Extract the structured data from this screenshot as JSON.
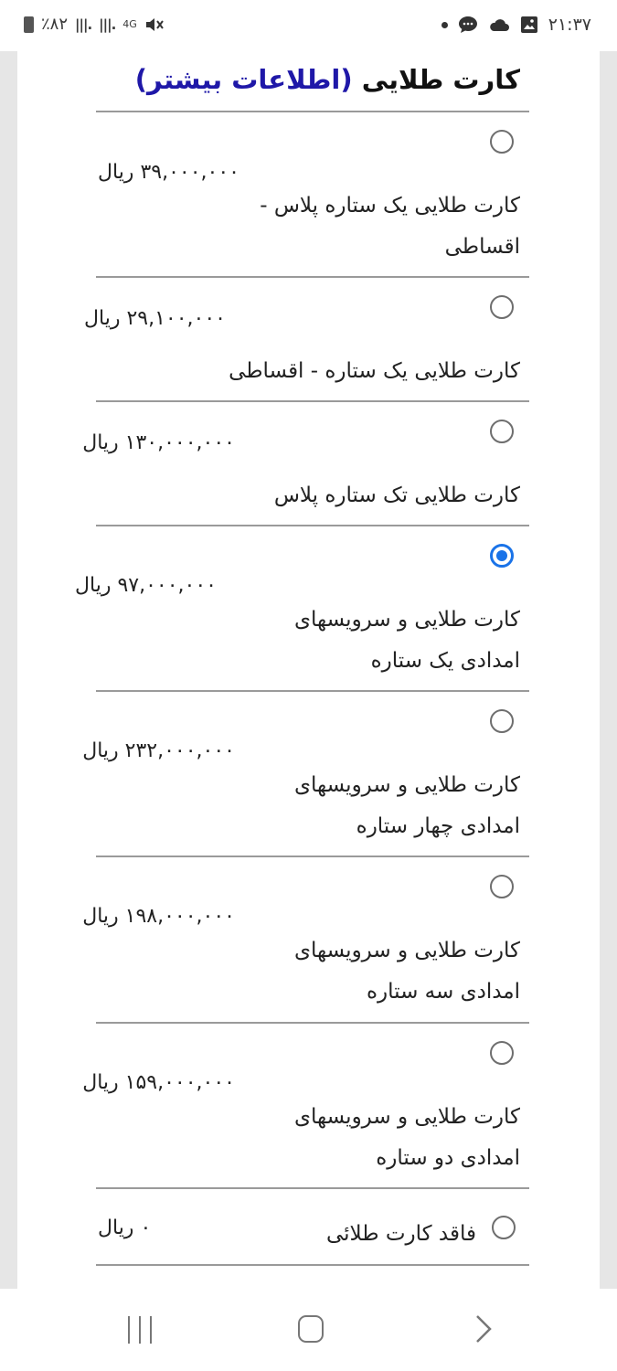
{
  "status_bar": {
    "time": "۲۱:۳۷",
    "battery": "٪۸۲",
    "network": "4G",
    "icons": [
      "gallery-icon",
      "cloud-icon",
      "chat-icon",
      "dot-icon",
      "mute-icon",
      "signal-icon",
      "signal-icon",
      "battery-icon"
    ]
  },
  "header": {
    "title": "کارت طلایی",
    "more_info": "(اطلاعات بیشتر)"
  },
  "options": [
    {
      "price": "۳۹,۰۰۰,۰۰۰ ریال",
      "name": "کارت طلایی یک ستاره پلاس - اقساطی",
      "selected": false
    },
    {
      "price": "۲۹,۱۰۰,۰۰۰ ریال",
      "name": "کارت طلایی یک ستاره - اقساطی",
      "selected": false
    },
    {
      "price": "۱۳۰,۰۰۰,۰۰۰ ریال",
      "name": "کارت طلایی تک ستاره پلاس",
      "selected": false
    },
    {
      "price": "۹۷,۰۰۰,۰۰۰ ریال",
      "name": "کارت طلایی و سرویسهای امدادی یک ستاره",
      "selected": true
    },
    {
      "price": "۲۳۲,۰۰۰,۰۰۰ ریال",
      "name": "کارت طلایی و سرویسهای امدادی چهار ستاره",
      "selected": false
    },
    {
      "price": "۱۹۸,۰۰۰,۰۰۰ ریال",
      "name": "کارت طلایی و سرویسهای امدادی سه ستاره",
      "selected": false
    },
    {
      "price": "۱۵۹,۰۰۰,۰۰۰ ریال",
      "name": "کارت طلایی و سرویسهای امدادی دو ستاره",
      "selected": false
    },
    {
      "price": "۰ ریال",
      "name": "فاقد کارت طلائی",
      "selected": false
    }
  ],
  "colors": {
    "accent": "#1a73e8",
    "link": "#1f18a8"
  },
  "nav_bar": {
    "icons": [
      "recent-apps-icon",
      "home-icon",
      "back-icon"
    ]
  }
}
